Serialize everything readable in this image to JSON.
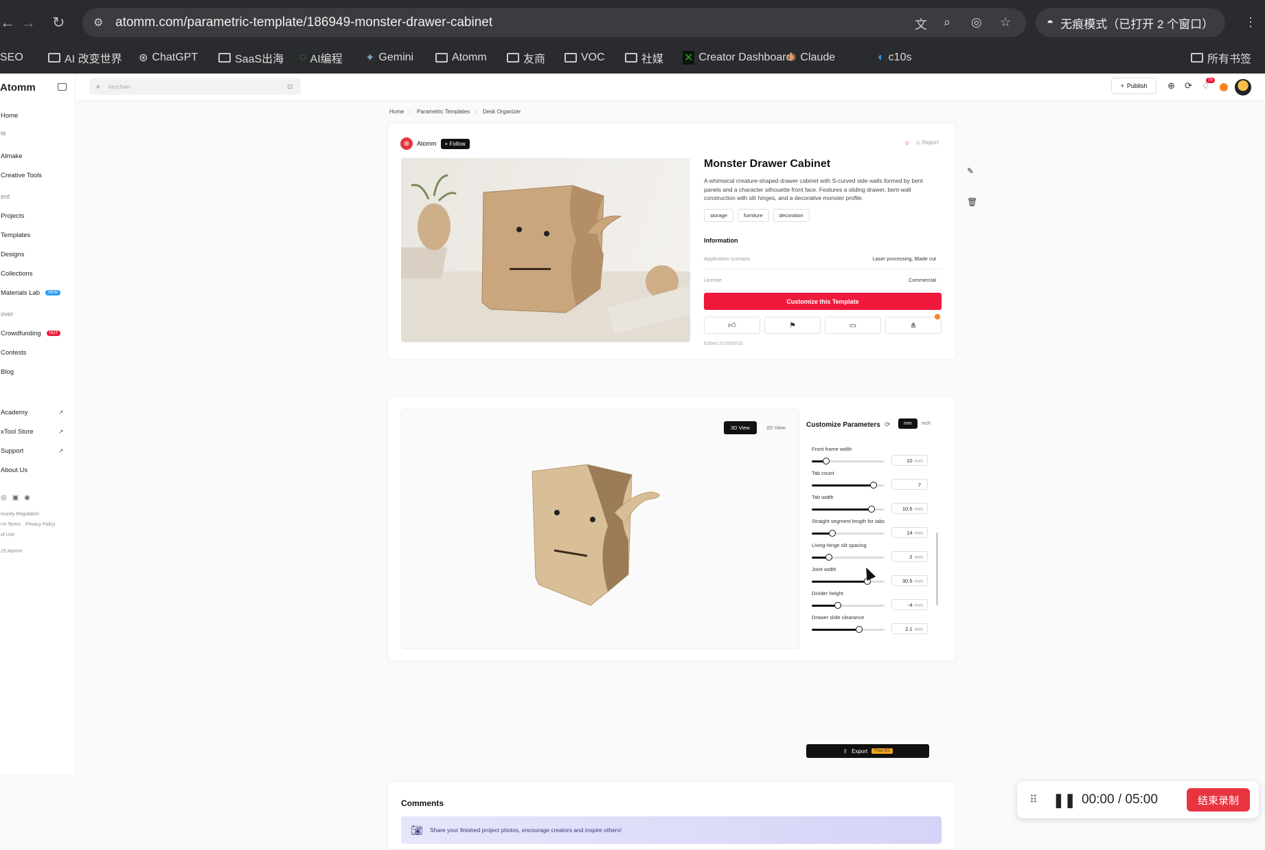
{
  "browser": {
    "url": "atomm.com/parametric-template/186949-monster-drawer-cabinet",
    "incognito_label": "无痕模式（已打开 2 个窗口）",
    "bookmarks": [
      "SEO",
      "AI 改变世界",
      "ChatGPT",
      "SaaS出海",
      "AI编程",
      "Gemini",
      "Atomm",
      "友商",
      "VOC",
      "社媒",
      "Creator Dashboard",
      "Claude",
      "c10s"
    ],
    "all_bookmarks": "所有书签"
  },
  "sidebar": {
    "logo": "Atomm",
    "items": [
      {
        "label": "Home"
      },
      {
        "label": "te"
      },
      {
        "label": "Almake"
      },
      {
        "label": "Creative Tools"
      },
      {
        "label": "ent"
      },
      {
        "label": "Projects"
      },
      {
        "label": "Templates"
      },
      {
        "label": "Designs"
      },
      {
        "label": "Collections"
      },
      {
        "label": "Materials Lab",
        "badge": "NEW"
      },
      {
        "label": "over"
      },
      {
        "label": "Crowdfunding",
        "badge": "HOT"
      },
      {
        "label": "Contests"
      },
      {
        "label": "Blog"
      },
      {
        "label": "Academy"
      },
      {
        "label": "xTool Store"
      },
      {
        "label": "Support"
      },
      {
        "label": "About Us"
      }
    ],
    "footer": [
      "munity Regulation",
      "rm Terms",
      "Privacy Policy",
      "of Use",
      "25 Atomm"
    ]
  },
  "topbar": {
    "search_placeholder": "keychain",
    "publish_label": "Publish",
    "notif_count": "74"
  },
  "breadcrumb": [
    "Home",
    "Parametric Templates",
    "Desk Organizer"
  ],
  "author": {
    "name": "Atomm",
    "follow_label": "+ Follow"
  },
  "report_label": "Report",
  "template": {
    "title": "Monster Drawer Cabinet",
    "description": "A whimsical creature-shaped drawer cabinet with S-curved side walls formed by bent panels and a character silhouette front face. Features a sliding drawer, bent-wall construction with slit hinges, and a decorative monster profile.",
    "tags": [
      "storage",
      "furniture",
      "decoration"
    ],
    "info_title": "Information",
    "info": [
      {
        "label": "Application scenario",
        "value": "Laser processing,  Blade cut"
      },
      {
        "label": "License",
        "value": "Commercial"
      }
    ],
    "cta_label": "Customize this Template",
    "edited": "Edited 2026/08/10"
  },
  "viewer": {
    "tab_3d": "3D View",
    "tab_2d": "2D View"
  },
  "params": {
    "title": "Customize Parameters",
    "unit_mm": "mm",
    "unit_inch": "inch",
    "items": [
      {
        "label": "Front frame width",
        "value": "10",
        "unit": "mm",
        "level": 0.2
      },
      {
        "label": "Tab count",
        "value": "7",
        "unit": "",
        "level": 0.85
      },
      {
        "label": "Tab width",
        "value": "10.5",
        "unit": "mm",
        "level": 0.82
      },
      {
        "label": "Straight segment length for tabs",
        "value": "14",
        "unit": "mm",
        "level": 0.28
      },
      {
        "label": "Living-hinge slit spacing",
        "value": "2",
        "unit": "mm",
        "level": 0.24
      },
      {
        "label": "Joint width",
        "value": "30.5",
        "unit": "mm",
        "level": 0.76
      },
      {
        "label": "Divider height",
        "value": "-4",
        "unit": "mm",
        "level": 0.36
      },
      {
        "label": "Drawer slide clearance",
        "value": "2.1",
        "unit": "mm",
        "level": 0.65
      }
    ],
    "export_label": "Export",
    "free_label": "Free 3/3"
  },
  "comments": {
    "title": "Comments",
    "banner": "Share your finished project photos, encourage creators and inspire others!"
  },
  "recorder": {
    "time": "00:00  /  05:00",
    "stop_label": "结束录制"
  },
  "colors": {
    "accent": "#f0193c",
    "dark": "#111111"
  }
}
